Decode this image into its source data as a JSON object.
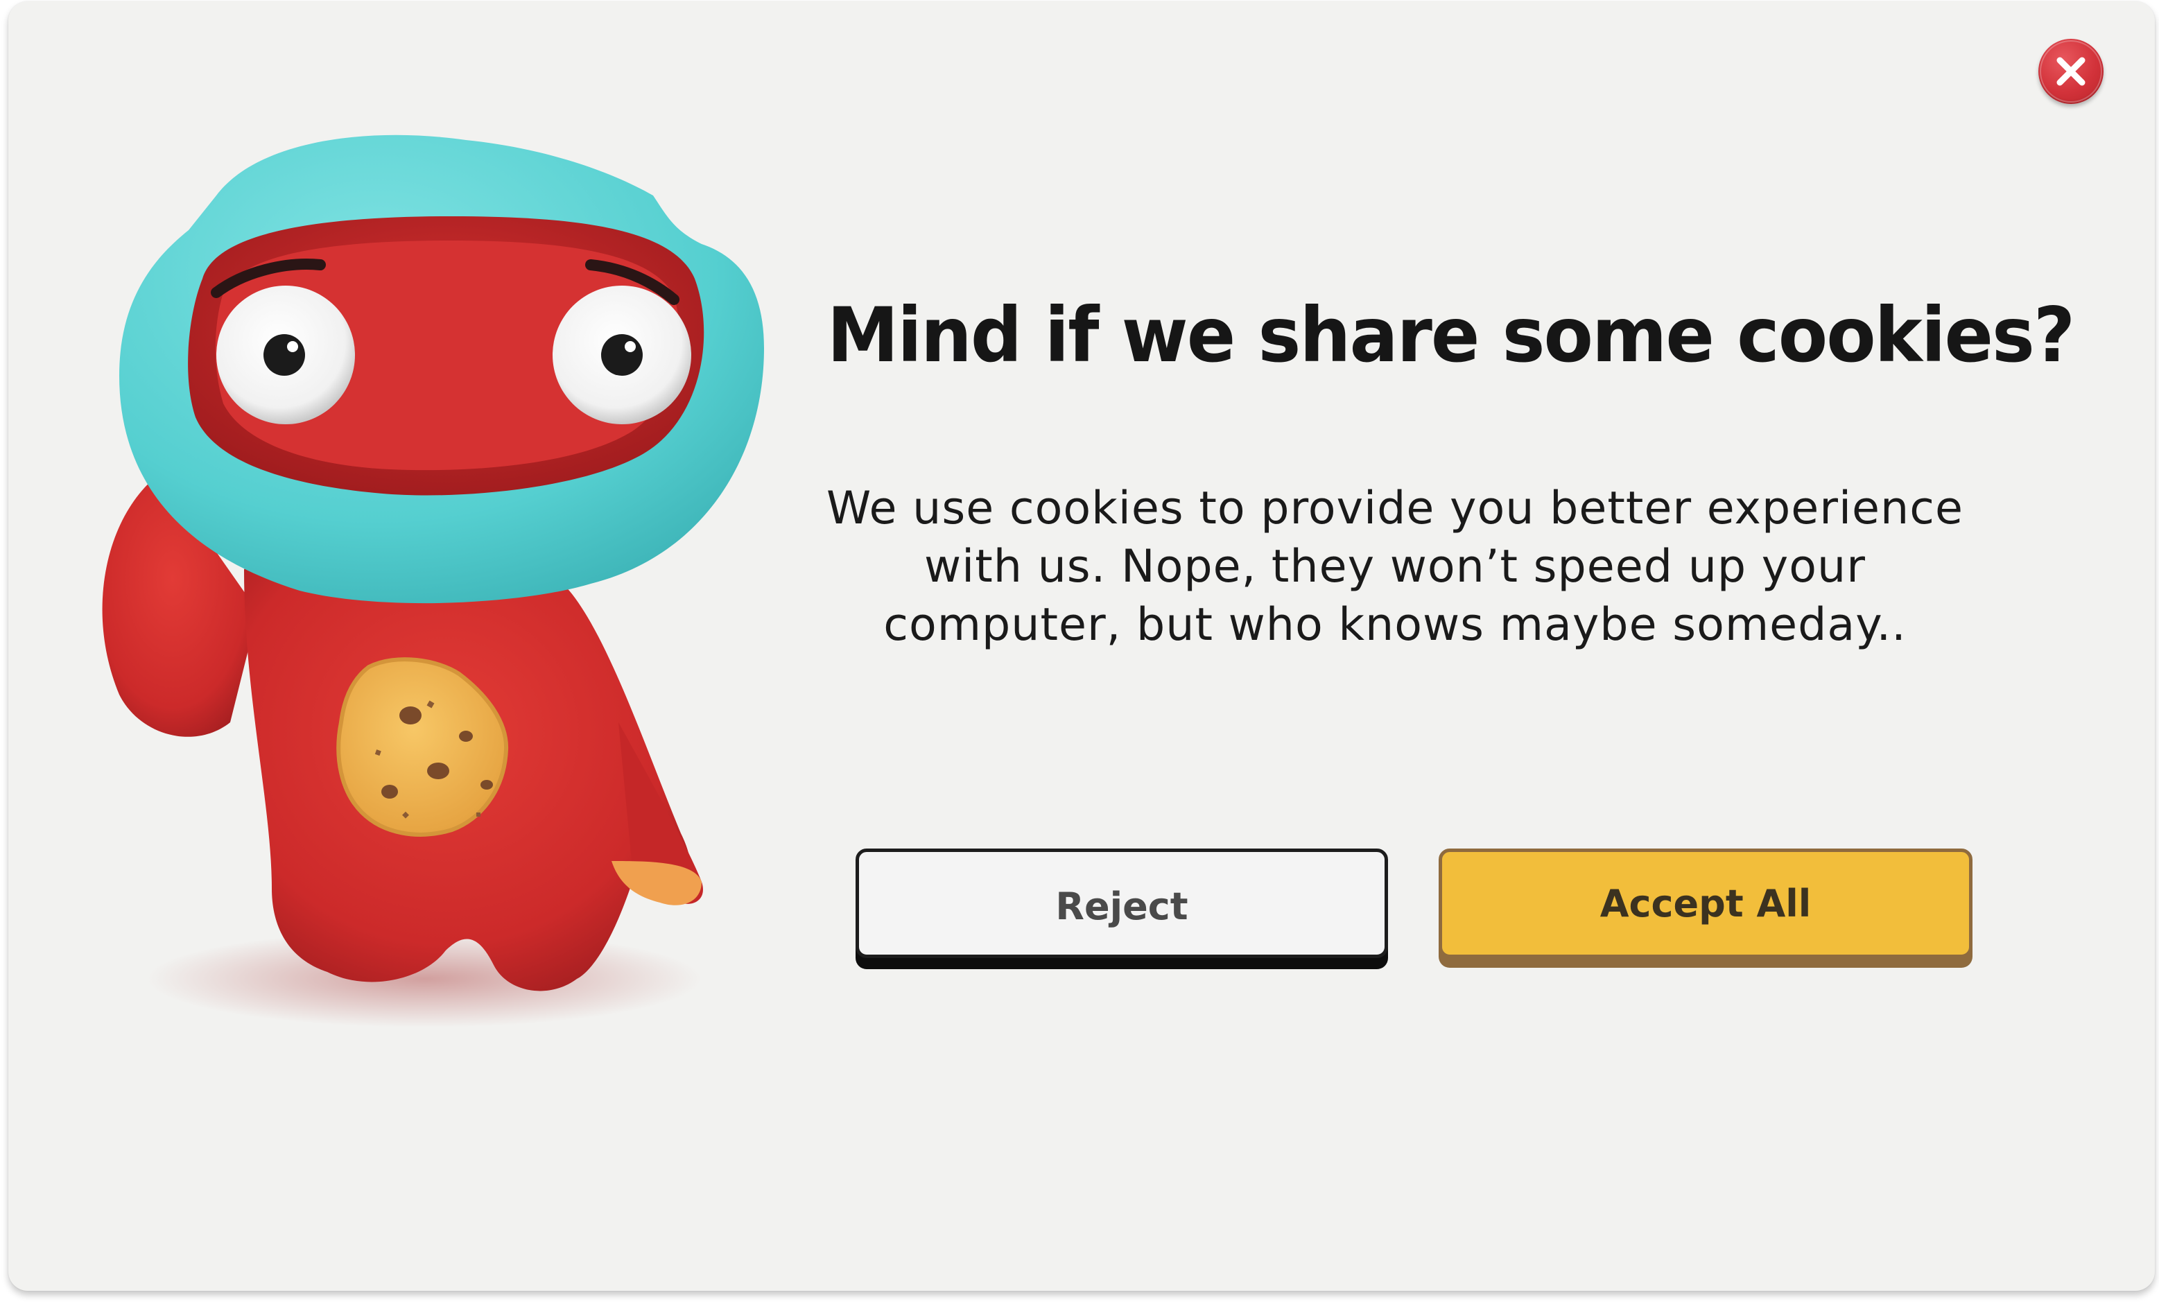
{
  "dialog": {
    "title": "Mind if we share some cookies?",
    "body_lines": [
      "We use cookies to provide you better experience",
      "with us. Nope, they won’t speed up your",
      "computer, but who knows maybe someday.."
    ],
    "close_icon": "close-x-icon",
    "mascot": "cookie-monster-mascot-illustration"
  },
  "buttons": {
    "reject_label": "Reject",
    "accept_label": "Accept All"
  },
  "colors": {
    "dialog_background": "#f2f2f0",
    "accept_button": "#f2be3b",
    "accept_border": "#8f6b3e",
    "reject_button": "#f4f4f4",
    "reject_border": "#1d1d1d",
    "close_button": "#d2323a",
    "mascot_body": "#d43030",
    "mascot_hood": "#5fd3d4",
    "cookie": "#f2b44e"
  }
}
